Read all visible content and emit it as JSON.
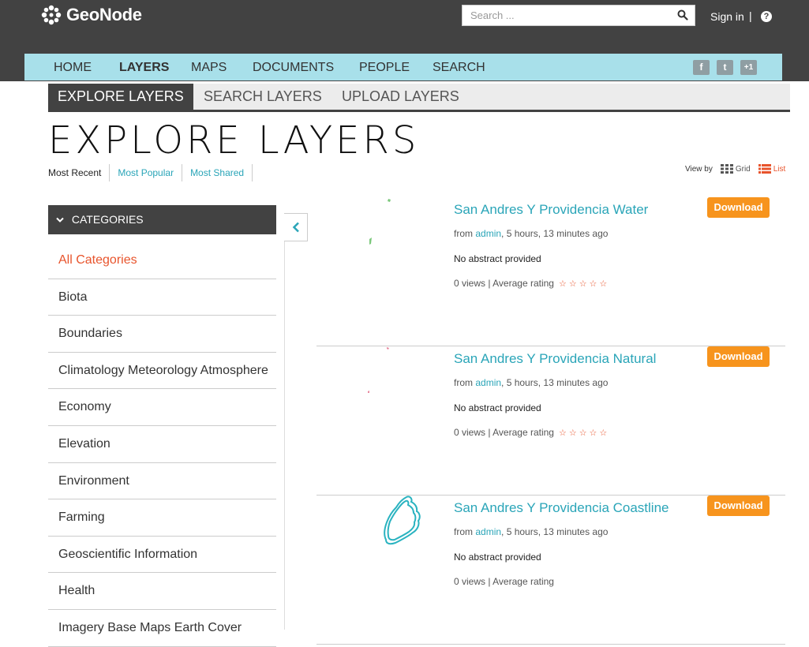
{
  "brand": {
    "name": "GeoNode",
    "icon": "geonode-logo-icon"
  },
  "search": {
    "placeholder": "Search ...",
    "icon": "search-icon"
  },
  "account": {
    "signin": "Sign in",
    "divider": "|",
    "help": "?"
  },
  "nav": {
    "items": [
      {
        "label": "HOME"
      },
      {
        "label": "LAYERS"
      },
      {
        "label": "MAPS"
      },
      {
        "label": "DOCUMENTS"
      },
      {
        "label": "PEOPLE"
      },
      {
        "label": "SEARCH"
      }
    ],
    "active_index": 1,
    "social": [
      {
        "icon": "facebook-icon",
        "glyph": "f"
      },
      {
        "icon": "twitter-icon",
        "glyph": "t"
      },
      {
        "icon": "google-plus-icon",
        "glyph": "+1"
      }
    ]
  },
  "subtabs": [
    {
      "label": "EXPLORE LAYERS"
    },
    {
      "label": "SEARCH LAYERS"
    },
    {
      "label": "UPLOAD LAYERS"
    }
  ],
  "page": {
    "title": "EXPLORE LAYERS",
    "sort": [
      "Most Recent",
      "Most Popular",
      "Most Shared"
    ],
    "view_by": "View by",
    "view_options": [
      {
        "label": "Grid",
        "icon": "grid-icon"
      },
      {
        "label": "List",
        "icon": "list-icon"
      }
    ]
  },
  "categories": {
    "header": "CATEGORIES",
    "items": [
      "All Categories",
      "Biota",
      "Boundaries",
      "Climatology Meteorology Atmosphere",
      "Economy",
      "Elevation",
      "Environment",
      "Farming",
      "Geoscientific Information",
      "Health",
      "Imagery Base Maps Earth Cover"
    ]
  },
  "layers": [
    {
      "title": "San Andres Y Providencia Water",
      "download": "Download",
      "from": "from",
      "owner": "admin",
      "time": ", 5 hours, 13 minutes ago",
      "abstract": "No abstract provided",
      "views": "0 views | Average rating",
      "stars": "☆☆☆☆☆",
      "thumb_color": "#7cc87c"
    },
    {
      "title": "San Andres Y Providencia Natural",
      "download": "Download",
      "from": "from",
      "owner": "admin",
      "time": ", 5 hours, 13 minutes ago",
      "abstract": "No abstract provided",
      "views": "0 views | Average rating",
      "stars": "☆☆☆☆☆",
      "thumb_color": "#e88aa0"
    },
    {
      "title": "San Andres Y Providencia Coastline",
      "download": "Download",
      "from": "from",
      "owner": "admin",
      "time": ", 5 hours, 13 minutes ago",
      "abstract": "No abstract provided",
      "views": "0 views | Average rating",
      "stars": "",
      "thumb_color": "#2ab3c0"
    }
  ]
}
